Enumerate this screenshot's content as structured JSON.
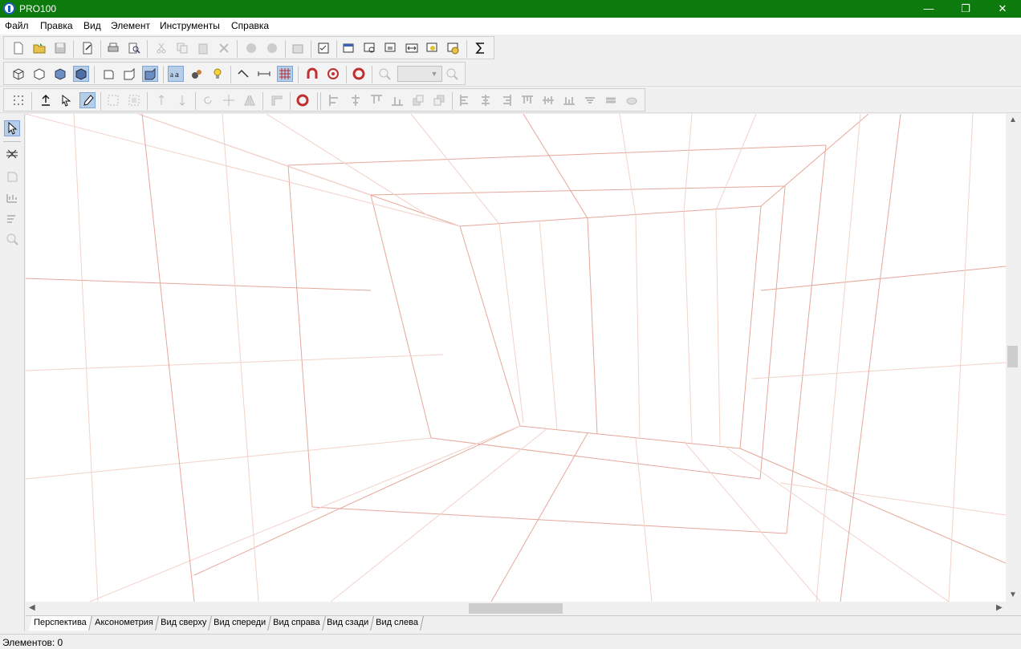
{
  "window": {
    "title": "PRO100",
    "minimize_glyph": "—",
    "restore_glyph": "❐",
    "close_glyph": "✕"
  },
  "menu": [
    "Файл",
    "Правка",
    "Вид",
    "Элемент",
    "Инструменты",
    "Справка"
  ],
  "toolbar1_icons": [
    "new-file-icon",
    "open-folder-icon",
    "save-icon",
    "properties-icon",
    "print-icon",
    "print-preview-icon",
    "cut-icon",
    "copy-icon",
    "paste-icon",
    "delete-icon",
    "undo-icon",
    "redo-icon",
    "library-icon",
    "checklist-icon",
    "window-icon",
    "window-search-icon",
    "window-list-icon",
    "window-size-icon",
    "window-paint-icon",
    "window-money-icon",
    "sigma-icon"
  ],
  "toolbar2_icons": [
    "wireframe-cube-icon",
    "hidden-lines-cube-icon",
    "solid-cube-icon",
    "shaded-cube-icon",
    "box-view-icon",
    "box-side-icon",
    "box-solid-icon",
    "text-size-icon",
    "materials-icon",
    "light-bulb-icon",
    "scale-icon",
    "dimension-icon",
    "grid-icon",
    "magnet-icon",
    "target-icon",
    "lifebuoy-icon",
    "zoom-out-icon",
    "zoom-in-icon"
  ],
  "toolbar3_icons": [
    "select-points-icon",
    "insert-element-icon",
    "move-cursor-icon",
    "edit-pencil-icon",
    "group-icon",
    "ungroup-icon",
    "move-up-icon",
    "move-down-icon",
    "rotate-icon",
    "move-cross-icon",
    "mirror-icon",
    "corner-icon",
    "lifebuoy-icon",
    "align-left-icon",
    "align-center-icon",
    "align-top-icon",
    "align-bottom-icon",
    "bring-front-icon",
    "send-back-icon",
    "distribute-left-icon",
    "distribute-center-icon",
    "distribute-right-icon",
    "distribute-top-icon",
    "distribute-middle-icon",
    "distribute-bottom-icon",
    "sort-icon",
    "stack-icon",
    "pan-icon"
  ],
  "left_tools": [
    "pointer-icon",
    "hatch-icon",
    "box-icon",
    "graph-icon",
    "edit-list-icon",
    "magnifier-icon"
  ],
  "tabs": [
    "Перспектива",
    "Аксонометрия",
    "Вид сверху",
    "Вид спереди",
    "Вид справа",
    "Вид сзади",
    "Вид слева"
  ],
  "active_tab": "Перспектива",
  "status": {
    "elements": "Элементов: 0"
  },
  "colors": {
    "titlebar": "#0d7a0d",
    "grid_line": "#e6a79a",
    "grid_line_light": "#f2d2ca",
    "active_button": "#b5cde8"
  },
  "zoom_field_value": ""
}
